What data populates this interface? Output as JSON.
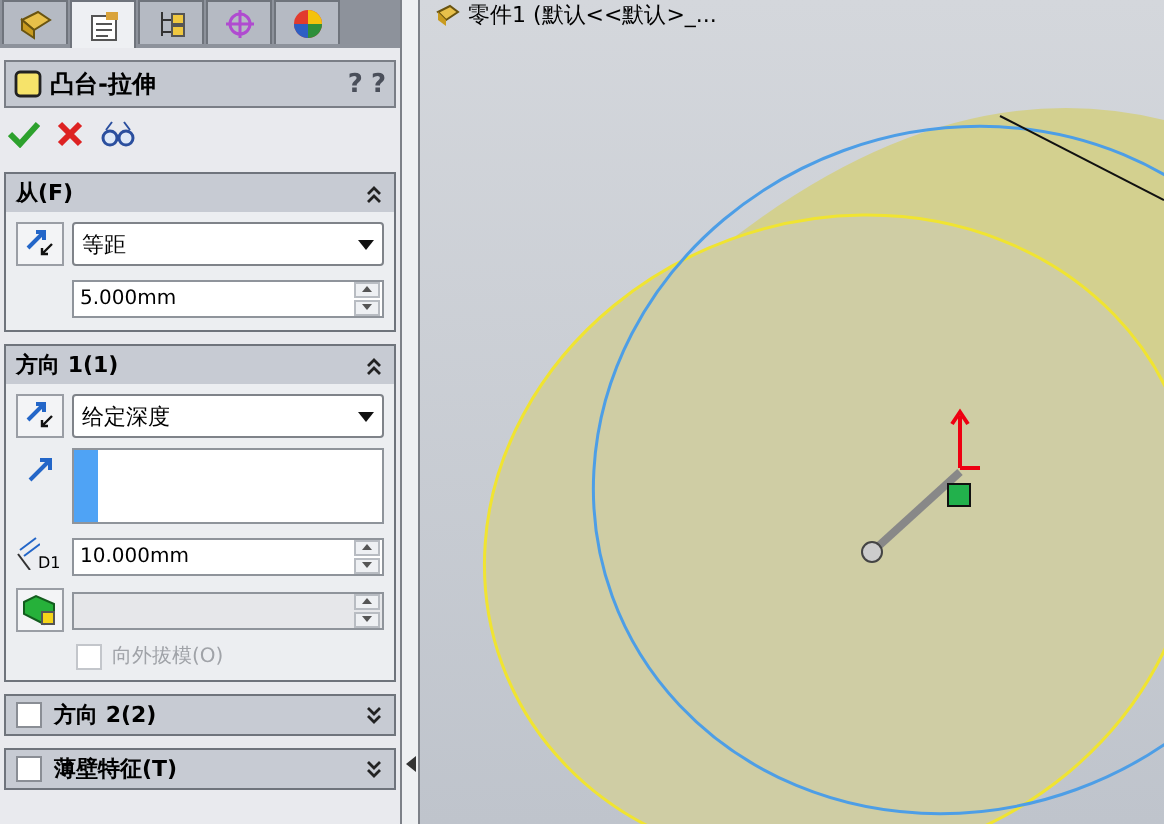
{
  "tabs": [
    {
      "selected": false
    },
    {
      "selected": true
    },
    {
      "selected": false
    },
    {
      "selected": false
    },
    {
      "selected": false
    }
  ],
  "feature": {
    "title": "凸台-拉伸",
    "help_marks": [
      "?",
      "?"
    ]
  },
  "from_section": {
    "title": "从(F)",
    "expanded": true,
    "end_condition": "等距",
    "offset": "5.000mm"
  },
  "direction1": {
    "title": "方向 1(1)",
    "expanded": true,
    "end_condition": "给定深度",
    "depth": "10.000mm",
    "dimension_label": "D1",
    "draft_outward": {
      "label": "向外拔模(O)",
      "checked": false,
      "disabled": true
    }
  },
  "collapsed_sections": [
    {
      "title": "方向 2(2)",
      "checked": false,
      "expanded": false
    },
    {
      "title": "薄壁特征(T)",
      "checked": false,
      "expanded": false
    }
  ],
  "viewport": {
    "tree_label": "零件1 (默认<<默认>_..."
  }
}
